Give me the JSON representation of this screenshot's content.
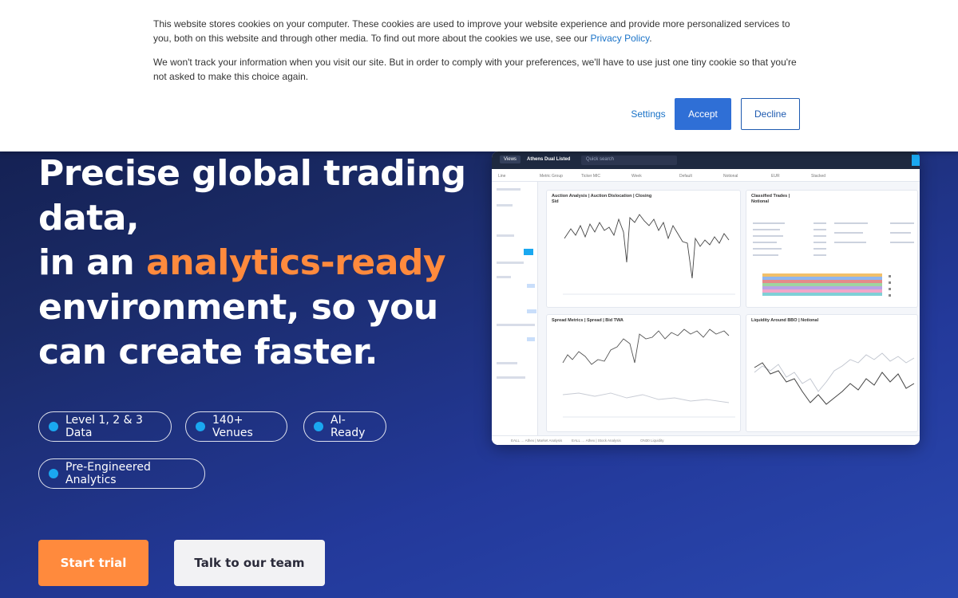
{
  "cookie_banner": {
    "text_1_before_link": "This website stores cookies on your computer. These cookies are used to improve your website experience and provide more personalized services to you, both on this website and through other media. To find out more about the cookies we use, see our ",
    "privacy_link": "Privacy Policy",
    "text_1_after_link": ".",
    "text_2": "We won't track your information when you visit our site. But in order to comply with your preferences, we'll have to use just one tiny cookie so that you're not asked to make this choice again.",
    "settings_label": "Settings",
    "accept_label": "Accept",
    "decline_label": "Decline",
    "link_color": "#1a73c8",
    "accept_color": "#2f6fd6"
  },
  "hero": {
    "line_1": "Precise global trading data,",
    "line_2_prefix": "in an ",
    "line_2_accent": "analytics-ready",
    "line_3": "environment, so you can create faster.",
    "accent_color": "#ff8a3d",
    "features": [
      {
        "label": "Level 1, 2 & 3 Data"
      },
      {
        "label": "140+ Venues"
      },
      {
        "label": "AI-Ready"
      },
      {
        "label": "Pre-Engineered Analytics"
      }
    ],
    "dot_color": "#1aa8f0",
    "primary_cta": "Start trial",
    "secondary_cta": "Talk to our team"
  },
  "dashboard": {
    "views_label": "Views",
    "tab_label": "Athens Dual Listed",
    "search_placeholder": "Quick search",
    "filters": [
      "Line",
      "Metric Group",
      "Ticker MIC",
      "Week",
      "Default",
      "Notional",
      "EUR",
      "Stacked"
    ],
    "panels": [
      {
        "title": "Auction Analysis | Auction Dislocation | Closing Sid"
      },
      {
        "title": "Classified Trades | Notional"
      },
      {
        "title": "Spread Metrics | Spread | Bid TWA"
      },
      {
        "title": "Liquidity Around BBO | Notional"
      }
    ],
    "bottom_tabs": [
      "EALL … Athex | Market Analysis",
      "EALL … Athex | Stock Analysis",
      "ON30 Liquidity"
    ]
  }
}
